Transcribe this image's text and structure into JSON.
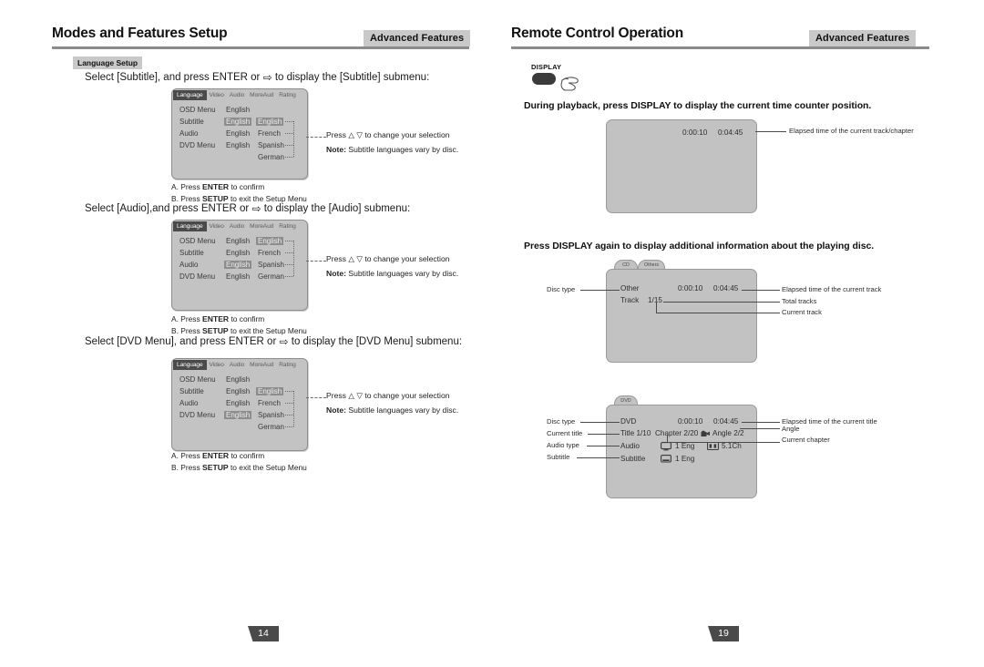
{
  "left_page": {
    "header": {
      "title": "Modes and Features Setup",
      "badge": "Advanced Features"
    },
    "section_tag": "Language Setup",
    "steps": [
      {
        "text": "Select [Subtitle], and press ENTER or",
        "text_after": "to display the [Subtitle] submenu:"
      },
      {
        "text": "Select [Audio],and press ENTER or",
        "text_after": "to display the [Audio] submenu:"
      },
      {
        "text": "Select [DVD Menu], and press ENTER or",
        "text_after": "to display the [DVD Menu] submenu:"
      }
    ],
    "osd_tabs": [
      "Language",
      "Video",
      "Audio",
      "MoreAud",
      "Rating"
    ],
    "osd_rows": [
      {
        "label": "OSD Menu",
        "value": "English"
      },
      {
        "label": "Subtitle",
        "value": "English"
      },
      {
        "label": "Audio",
        "value": "English"
      },
      {
        "label": "DVD Menu",
        "value": "English"
      }
    ],
    "osd_options": [
      "English",
      "French",
      "Spanish",
      "German"
    ],
    "menus": [
      {
        "selected_row": 1,
        "selected_option": 0
      },
      {
        "selected_row": 2,
        "selected_option": 0
      },
      {
        "selected_row": 3,
        "selected_option": 0
      }
    ],
    "note": {
      "line1": "Press",
      "line1_after": "to change your selection",
      "note_label": "Note:",
      "line2": "Subtitle languages vary by disc."
    },
    "confirm_steps": [
      {
        "letter": "A.",
        "pre": "Press",
        "key": "ENTER",
        "post": "to confirm"
      },
      {
        "letter": "B.",
        "pre": "Press",
        "key": "SETUP",
        "post": "to exit the Setup Menu"
      }
    ],
    "page_number": "14"
  },
  "right_page": {
    "header": {
      "title": "Remote Control Operation",
      "badge": "Advanced Features"
    },
    "display_button_label": "DISPLAY",
    "instruction_1": "During playback, press DISPLAY to display the current time counter position.",
    "instruction_2": "Press DISPLAY again to display additional information about the playing  disc.",
    "screen_1": {
      "time_elapsed": "0:00:10",
      "time_total": "0:04:45",
      "callout": "Elapsed time of the current track/chapter"
    },
    "screen_2": {
      "tabs": [
        "CD",
        "Others"
      ],
      "disc_type_value": "Other",
      "time_elapsed": "0:00:10",
      "time_total": "0:04:45",
      "track_label": "Track",
      "track_value": "1/15",
      "left_callouts": [
        "Disc type"
      ],
      "right_callouts": [
        "Elapsed time of the current track",
        "Total tracks",
        "Current track"
      ]
    },
    "screen_3": {
      "tab": "DVD",
      "disc_type_value": "DVD",
      "time_elapsed": "0:00:10",
      "time_total": "0:04:45",
      "title_text": "Title 1/10",
      "chapter_text": "Chapter 2/20",
      "angle_text": "Angle  2/2",
      "audio_label": "Audio",
      "audio_value": "1 Eng",
      "audio_channel": "5.1Ch",
      "subtitle_label": "Subtitle",
      "subtitle_value": "1 Eng",
      "left_callouts": [
        "Disc type",
        "Current title",
        "Audio type",
        "Subtitle"
      ],
      "right_callouts": [
        "Elapsed time of the current title",
        "Angle",
        "Current chapter"
      ]
    },
    "page_number": "19"
  }
}
